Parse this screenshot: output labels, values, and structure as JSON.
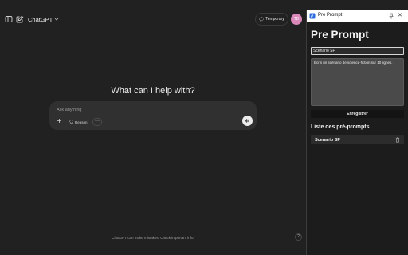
{
  "chatgpt": {
    "model_label": "ChatGPT",
    "temporary_label": "Temporary",
    "avatar_initials": "TD",
    "heading": "What can I help with?",
    "composer": {
      "placeholder": "Ask anything",
      "reason_label": "Reason",
      "more_label": "···"
    },
    "footer_note": "ChatGPT can make mistakes. Check important info.",
    "help_label": "?"
  },
  "panel": {
    "header_title": "Pre Prompt",
    "title": "Pre Prompt",
    "name_value": "Scenario SF",
    "prompt_value": "Ecris un scénario de science-fiction sur 10 lignes.",
    "save_label": "Enregistrer",
    "list_title": "Liste des pré-prompts",
    "items": [
      {
        "label": "Scenario SF"
      }
    ]
  },
  "colors": {
    "background": "#212121",
    "composer": "#303030",
    "avatar": "#d988b9",
    "panel_background": "#1c1c1c"
  },
  "icons": [
    "sidebar-icon",
    "new-chat-icon",
    "chevron-down-icon",
    "chat-bubble-icon",
    "plus-icon",
    "lightbulb-icon",
    "voice-icon",
    "pin-icon",
    "close-icon",
    "trash-icon"
  ]
}
